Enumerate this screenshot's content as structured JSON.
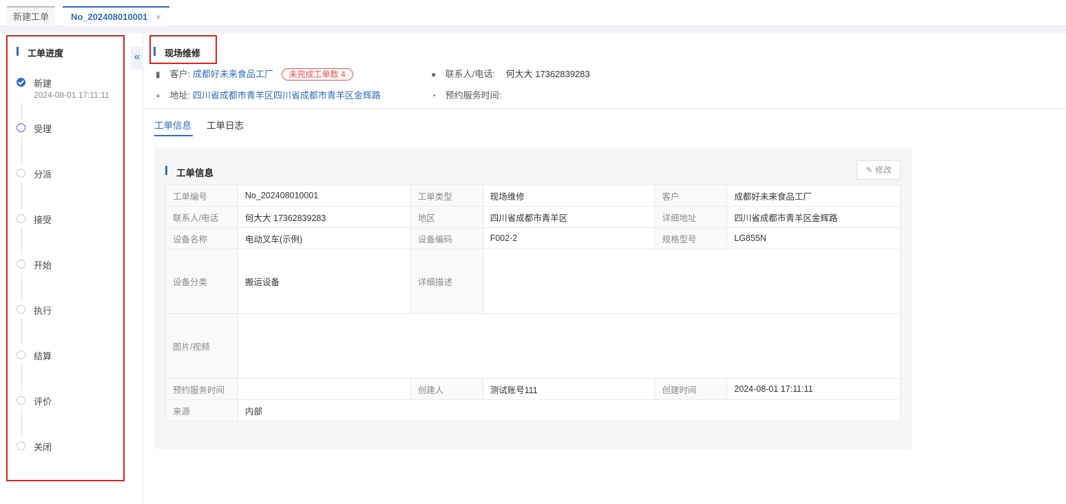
{
  "tabs": {
    "new_label": "新建工单",
    "active_label": "No_202408010001",
    "close_glyph": "×"
  },
  "sidebar": {
    "title": "工单进度",
    "collapse_glyph": "«",
    "steps": [
      {
        "label": "新建",
        "time": "2024-08-01 17:11:11",
        "state": "done"
      },
      {
        "label": "受理",
        "state": "current"
      },
      {
        "label": "分派",
        "state": "pending"
      },
      {
        "label": "接受",
        "state": "pending"
      },
      {
        "label": "开始",
        "state": "pending"
      },
      {
        "label": "执行",
        "state": "pending"
      },
      {
        "label": "结算",
        "state": "pending"
      },
      {
        "label": "评价",
        "state": "pending"
      },
      {
        "label": "关闭",
        "state": "pending"
      }
    ]
  },
  "header": {
    "title": "现场维修",
    "customer_label": "客户:",
    "customer_value": "成都好未来食品工厂",
    "badge": "未完成工单数 4",
    "contact_label": "联系人/电话:",
    "contact_value": "何大大 17362839283",
    "address_label": "地址:",
    "address_value": "四川省成都市青羊区四川省成都市青羊区金辉路",
    "appointment_label": "预约服务时间:"
  },
  "subtabs": {
    "info": "工单信息",
    "log": "工单日志"
  },
  "panel": {
    "title": "工单信息",
    "edit_label": "修改",
    "rows": {
      "r1": {
        "k1": "工单编号",
        "v1": "No_202408010001",
        "k2": "工单类型",
        "v2": "现场维修",
        "k3": "客户",
        "v3": "成都好未来食品工厂"
      },
      "r2": {
        "k1": "联系人/电话",
        "v1": "何大大 17362839283",
        "k2": "地区",
        "v2": "四川省成都市青羊区",
        "k3": "详细地址",
        "v3": "四川省成都市青羊区金辉路"
      },
      "r3": {
        "k1": "设备名称",
        "v1": "电动叉车(示例)",
        "k2": "设备编码",
        "v2": "F002-2",
        "k3": "规格型号",
        "v3": "LG855N"
      },
      "r4": {
        "k1": "设备分类",
        "v1": "搬运设备",
        "k2": "详细描述",
        "v2": ""
      },
      "r5": {
        "k1": "图片/视频",
        "v1": ""
      },
      "r6": {
        "k1": "预约服务时间",
        "v1": "",
        "k2": "创建人",
        "v2": "测试账号111",
        "k3": "创建时间",
        "v3": "2024-08-01 17:11:11"
      },
      "r7": {
        "k1": "来源",
        "v1": "内部"
      }
    }
  },
  "colors": {
    "accent": "#2f6bbd",
    "highlight": "#e02020",
    "badge": "#e35a5a"
  }
}
